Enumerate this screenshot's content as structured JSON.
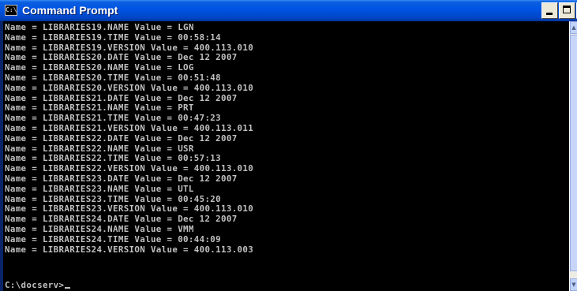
{
  "window": {
    "title": "Command Prompt",
    "icon": "cmd-console-icon",
    "icon_glyph": "C:\\"
  },
  "titlebar_buttons": {
    "minimize": "minimize-icon",
    "maximize": "maximize-icon",
    "close": "close-icon"
  },
  "console": {
    "lines": [
      "Name = LIBRARIES19.NAME Value = LGN",
      "Name = LIBRARIES19.TIME Value = 00:58:14",
      "Name = LIBRARIES19.VERSION Value = 400.113.010",
      "Name = LIBRARIES20.DATE Value = Dec 12 2007",
      "Name = LIBRARIES20.NAME Value = LOG",
      "Name = LIBRARIES20.TIME Value = 00:51:48",
      "Name = LIBRARIES20.VERSION Value = 400.113.010",
      "Name = LIBRARIES21.DATE Value = Dec 12 2007",
      "Name = LIBRARIES21.NAME Value = PRT",
      "Name = LIBRARIES21.TIME Value = 00:47:23",
      "Name = LIBRARIES21.VERSION Value = 400.113.011",
      "Name = LIBRARIES22.DATE Value = Dec 12 2007",
      "Name = LIBRARIES22.NAME Value = USR",
      "Name = LIBRARIES22.TIME Value = 00:57:13",
      "Name = LIBRARIES22.VERSION Value = 400.113.010",
      "Name = LIBRARIES23.DATE Value = Dec 12 2007",
      "Name = LIBRARIES23.NAME Value = UTL",
      "Name = LIBRARIES23.TIME Value = 00:45:20",
      "Name = LIBRARIES23.VERSION Value = 400.113.010",
      "Name = LIBRARIES24.DATE Value = Dec 12 2007",
      "Name = LIBRARIES24.NAME Value = VMM",
      "Name = LIBRARIES24.TIME Value = 00:44:09",
      "Name = LIBRARIES24.VERSION Value = 400.113.003"
    ],
    "prompt": "C:\\docserv>",
    "text_color": "#c0c0c0",
    "background_color": "#000000"
  },
  "colors": {
    "titlebar": "#0054e3",
    "close_button": "#d84b30",
    "button_face": "#ece9d8"
  }
}
